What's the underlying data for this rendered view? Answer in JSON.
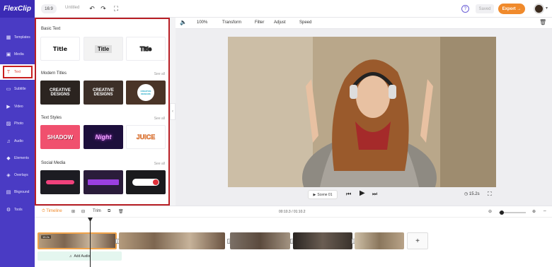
{
  "app": {
    "logo": "FlexClip",
    "ratio": "16:9",
    "project_name": "Untitled",
    "saved": "Saved",
    "export": "Export →"
  },
  "nav": [
    {
      "label": "Templates",
      "icon": "▦"
    },
    {
      "label": "Media",
      "icon": "▣"
    },
    {
      "label": "Text",
      "icon": "T"
    },
    {
      "label": "Subtitle",
      "icon": "▭"
    },
    {
      "label": "Video",
      "icon": "▶"
    },
    {
      "label": "Photo",
      "icon": "▨"
    },
    {
      "label": "Audio",
      "icon": "♫"
    },
    {
      "label": "Elements",
      "icon": "◆"
    },
    {
      "label": "Overlays",
      "icon": "◈"
    },
    {
      "label": "Bkground",
      "icon": "▤"
    },
    {
      "label": "Tools",
      "icon": "⚙"
    }
  ],
  "panel": {
    "basic_text": "Basic Text",
    "basic_tiles": [
      "Title",
      "Title",
      "Title"
    ],
    "modern_titles": "Modern Titles",
    "modern_tiles": [
      "CREATIVE DESIGNS",
      "CREATIVE DESIGNS",
      "CREATIVE DESIGNS"
    ],
    "text_styles": "Text Styles",
    "style_tiles": [
      "SHADOW",
      "Night",
      "JUICE"
    ],
    "social_media": "Social Media",
    "see_all": "See all"
  },
  "toolbar": {
    "zoom": "100%",
    "transform": "Transform",
    "filter": "Filter",
    "adjust": "Adjust",
    "speed": "Speed"
  },
  "player": {
    "scene": "Scene 01",
    "duration": "15.2s"
  },
  "timeline": {
    "label": "Timeline",
    "trim": "Trim",
    "time": "00:10.3 / 01:10.2",
    "add_audio": "Add Audio",
    "first_clip_tag": "15.2s"
  }
}
